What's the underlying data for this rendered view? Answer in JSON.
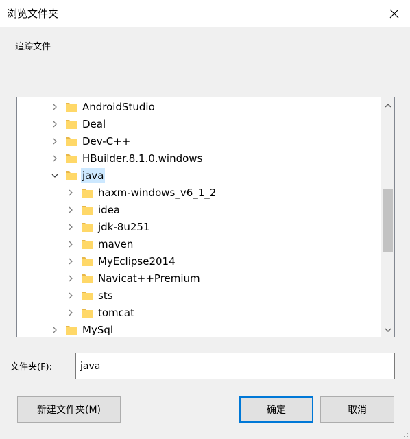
{
  "window": {
    "title": "浏览文件夹"
  },
  "description": "追踪文件",
  "tree": {
    "items": [
      {
        "label": "AndroidStudio",
        "level": 0,
        "expanded": false,
        "selected": false
      },
      {
        "label": "Deal",
        "level": 0,
        "expanded": false,
        "selected": false
      },
      {
        "label": "Dev-C++",
        "level": 0,
        "expanded": false,
        "selected": false
      },
      {
        "label": "HBuilder.8.1.0.windows",
        "level": 0,
        "expanded": false,
        "selected": false
      },
      {
        "label": "java",
        "level": 0,
        "expanded": true,
        "selected": true
      },
      {
        "label": "haxm-windows_v6_1_2",
        "level": 1,
        "expanded": false,
        "selected": false
      },
      {
        "label": "idea",
        "level": 1,
        "expanded": false,
        "selected": false
      },
      {
        "label": "jdk-8u251",
        "level": 1,
        "expanded": false,
        "selected": false
      },
      {
        "label": "maven",
        "level": 1,
        "expanded": false,
        "selected": false
      },
      {
        "label": "MyEclipse2014",
        "level": 1,
        "expanded": false,
        "selected": false
      },
      {
        "label": "Navicat++Premium",
        "level": 1,
        "expanded": false,
        "selected": false
      },
      {
        "label": "sts",
        "level": 1,
        "expanded": false,
        "selected": false
      },
      {
        "label": "tomcat",
        "level": 1,
        "expanded": false,
        "selected": false
      },
      {
        "label": "MySql",
        "level": 0,
        "expanded": false,
        "selected": false
      }
    ]
  },
  "folder_field": {
    "label": "文件夹(F):",
    "value": "java"
  },
  "buttons": {
    "new_folder": "新建文件夹(M)",
    "ok": "确定",
    "cancel": "取消"
  },
  "colors": {
    "folder": "#ffd868",
    "folder_dark": "#e8b84a",
    "selection": "#cce8ff",
    "accent": "#0078d7"
  }
}
